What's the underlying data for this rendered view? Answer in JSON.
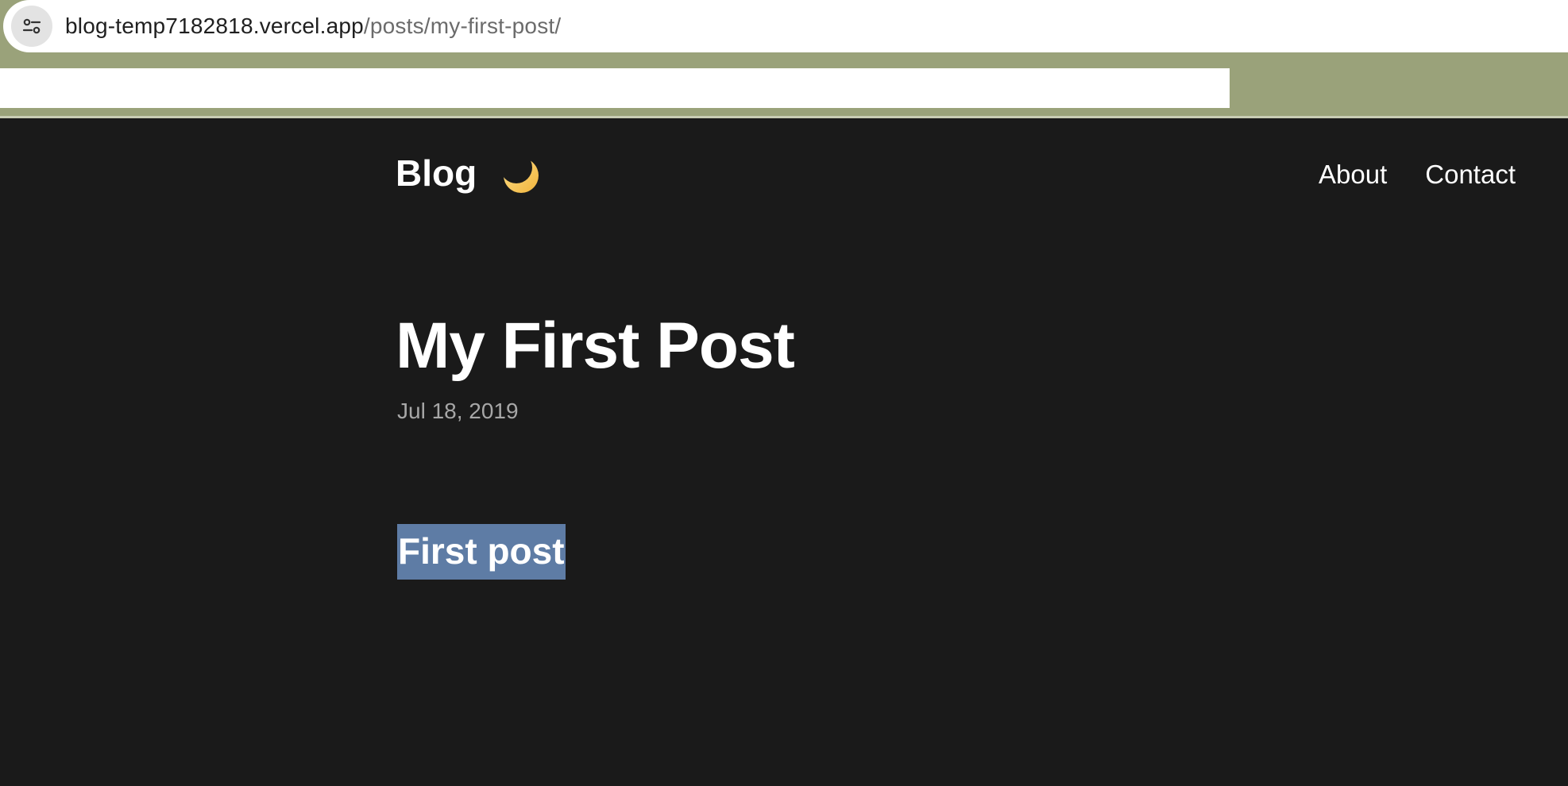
{
  "browser": {
    "url_host": "blog-temp7182818.vercel.app",
    "url_path": "/posts/my-first-post/",
    "site_controls_icon": "tune-icon"
  },
  "site": {
    "title": "Blog",
    "theme_toggle_icon": "crescent-moon-icon",
    "nav": [
      {
        "label": "About"
      },
      {
        "label": "Contact"
      }
    ]
  },
  "post": {
    "title": "My First Post",
    "date": "Jul 18, 2019",
    "body_heading": "First post"
  },
  "colors": {
    "background": "#1a1a1a",
    "chrome_band": "#9aa27a",
    "selection": "#5e7ca5",
    "date_text": "#a7a7a7",
    "moon": "#f5c85a"
  }
}
